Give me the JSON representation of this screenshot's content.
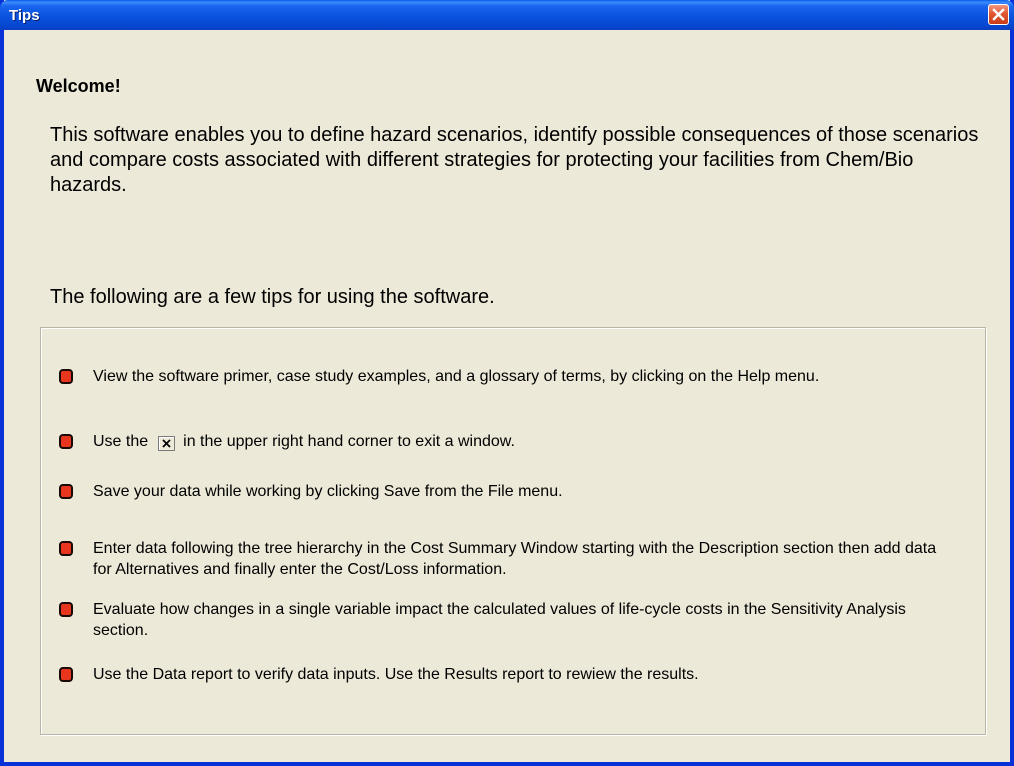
{
  "window": {
    "title": "Tips"
  },
  "welcome": "Welcome!",
  "intro": "This software enables you to define hazard scenarios, identify possible consequences of those scenarios and compare costs associated with different strategies for protecting your facilities from Chem/Bio hazards.",
  "tips_heading": "The following are a few tips for using the software.",
  "tips": [
    "View the software primer, case study examples, and a glossary of terms, by clicking on the Help menu.",
    {
      "before": "Use the",
      "icon": "close-icon",
      "after": "in the upper right hand corner to exit a window."
    },
    "Save your data while working by clicking Save from the File menu.",
    "Enter data following the tree hierarchy in the Cost Summary Window starting with the Description section then add data for Alternatives and finally enter the Cost/Loss information.",
    "Evaluate how changes in a single variable impact the calculated values of life-cycle costs in the Sensitivity Analysis section.",
    "Use the Data report to verify data inputs.  Use the Results report to rewiew the results."
  ],
  "colors": {
    "titlebar": "#0a52de",
    "window_bg": "#ece9d8",
    "close_button": "#e2572f",
    "bullet": "#e8361e"
  }
}
